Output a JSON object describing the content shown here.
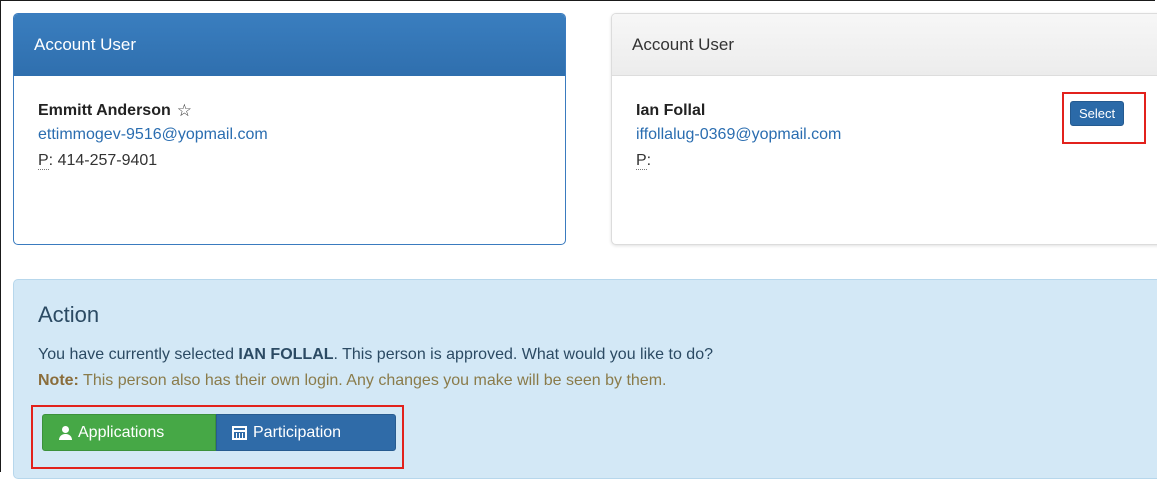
{
  "cards": [
    {
      "header": "Account User",
      "name": "Emmitt Anderson",
      "email": "ettimmogev-9516@yopmail.com",
      "phone_label": "P",
      "phone_value": "414-257-9401",
      "starred_icon": "star-outline-icon"
    },
    {
      "header": "Account User",
      "name": "Ian Follal",
      "email": "iffollalug-0369@yopmail.com",
      "phone_label": "P",
      "phone_value": "",
      "select_label": "Select"
    }
  ],
  "action": {
    "title": "Action",
    "text_prefix": "You have currently selected ",
    "selected_name": "IAN FOLLAL",
    "text_suffix": ". This person is approved. What would you like to do?",
    "note_label": "Note:",
    "note_text": " This person also has their own login. Any changes you make will be seen by them.",
    "buttons": {
      "applications": "Applications",
      "participation": "Participation"
    }
  },
  "colors": {
    "primary": "#2f6fae",
    "success": "#46a846",
    "highlight": "#e2211c",
    "panel_bg": "#d3e8f6"
  }
}
